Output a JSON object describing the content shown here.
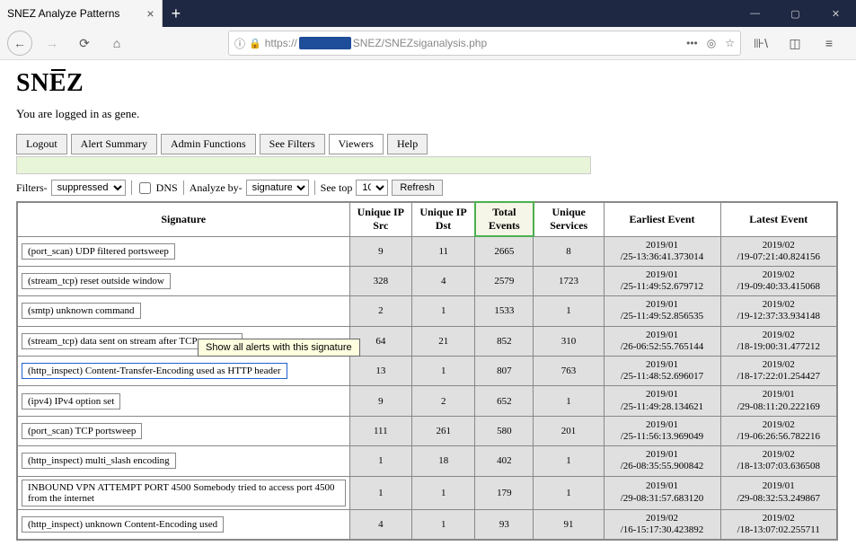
{
  "browser": {
    "tab_title": "SNEZ Analyze Patterns",
    "url_prefix": "https://",
    "url_suffix": "SNEZ/SNEZsiganalysis.php"
  },
  "page": {
    "title": "SNĒZ",
    "login_text": "You are logged in as gene."
  },
  "menu": {
    "logout": "Logout",
    "alert_summary": "Alert Summary",
    "admin_functions": "Admin Functions",
    "see_filters": "See Filters",
    "viewers": "Viewers",
    "help": "Help"
  },
  "filters": {
    "filters_label": "Filters-",
    "filters_value": "suppressed",
    "dns_label": "DNS",
    "analyze_label": "Analyze by-",
    "analyze_value": "signature",
    "seetop_label": "See top",
    "seetop_value": "10",
    "refresh": "Refresh"
  },
  "tooltip": "Show all alerts with this signature",
  "table": {
    "headers": {
      "signature": "Signature",
      "unique_ip_src": "Unique IP Src",
      "unique_ip_dst": "Unique IP Dst",
      "total_events": "Total Events",
      "unique_services": "Unique Services",
      "earliest_event": "Earliest Event",
      "latest_event": "Latest Event"
    },
    "rows": [
      {
        "sig": "(port_scan) UDP filtered portsweep",
        "src": "9",
        "dst": "11",
        "tot": "2665",
        "svc": "8",
        "early": "2019/01\n/25-13:36:41.373014",
        "late": "2019/02\n/19-07:21:40.824156"
      },
      {
        "sig": "(stream_tcp) reset outside window",
        "src": "328",
        "dst": "4",
        "tot": "2579",
        "svc": "1723",
        "early": "2019/01\n/25-11:49:52.679712",
        "late": "2019/02\n/19-09:40:33.415068"
      },
      {
        "sig": "(smtp) unknown command",
        "src": "2",
        "dst": "1",
        "tot": "1533",
        "svc": "1",
        "early": "2019/01\n/25-11:49:52.856535",
        "late": "2019/02\n/19-12:37:33.934148"
      },
      {
        "sig": "(stream_tcp) data sent on stream after TCP reset sent",
        "src": "64",
        "dst": "21",
        "tot": "852",
        "svc": "310",
        "early": "2019/01\n/26-06:52:55.765144",
        "late": "2019/02\n/18-19:00:31.477212"
      },
      {
        "sig": "(http_inspect) Content-Transfer-Encoding used as HTTP header",
        "src": "13",
        "dst": "1",
        "tot": "807",
        "svc": "763",
        "early": "2019/01\n/25-11:48:52.696017",
        "late": "2019/02\n/18-17:22:01.254427",
        "highlighted": true
      },
      {
        "sig": "(ipv4) IPv4 option set",
        "src": "9",
        "dst": "2",
        "tot": "652",
        "svc": "1",
        "early": "2019/01\n/25-11:49:28.134621",
        "late": "2019/01\n/29-08:11:20.222169"
      },
      {
        "sig": "(port_scan) TCP portsweep",
        "src": "111",
        "dst": "261",
        "tot": "580",
        "svc": "201",
        "early": "2019/01\n/25-11:56:13.969049",
        "late": "2019/02\n/19-06:26:56.782216"
      },
      {
        "sig": "(http_inspect) multi_slash encoding",
        "src": "1",
        "dst": "18",
        "tot": "402",
        "svc": "1",
        "early": "2019/01\n/26-08:35:55.900842",
        "late": "2019/02\n/18-13:07:03.636508"
      },
      {
        "sig": "INBOUND VPN ATTEMPT PORT 4500 Somebody tried to access port 4500 from the internet",
        "src": "1",
        "dst": "1",
        "tot": "179",
        "svc": "1",
        "early": "2019/01\n/29-08:31:57.683120",
        "late": "2019/01\n/29-08:32:53.249867"
      },
      {
        "sig": "(http_inspect) unknown Content-Encoding used",
        "src": "4",
        "dst": "1",
        "tot": "93",
        "svc": "91",
        "early": "2019/02\n/16-15:17:30.423892",
        "late": "2019/02\n/18-13:07:02.255711"
      }
    ]
  }
}
